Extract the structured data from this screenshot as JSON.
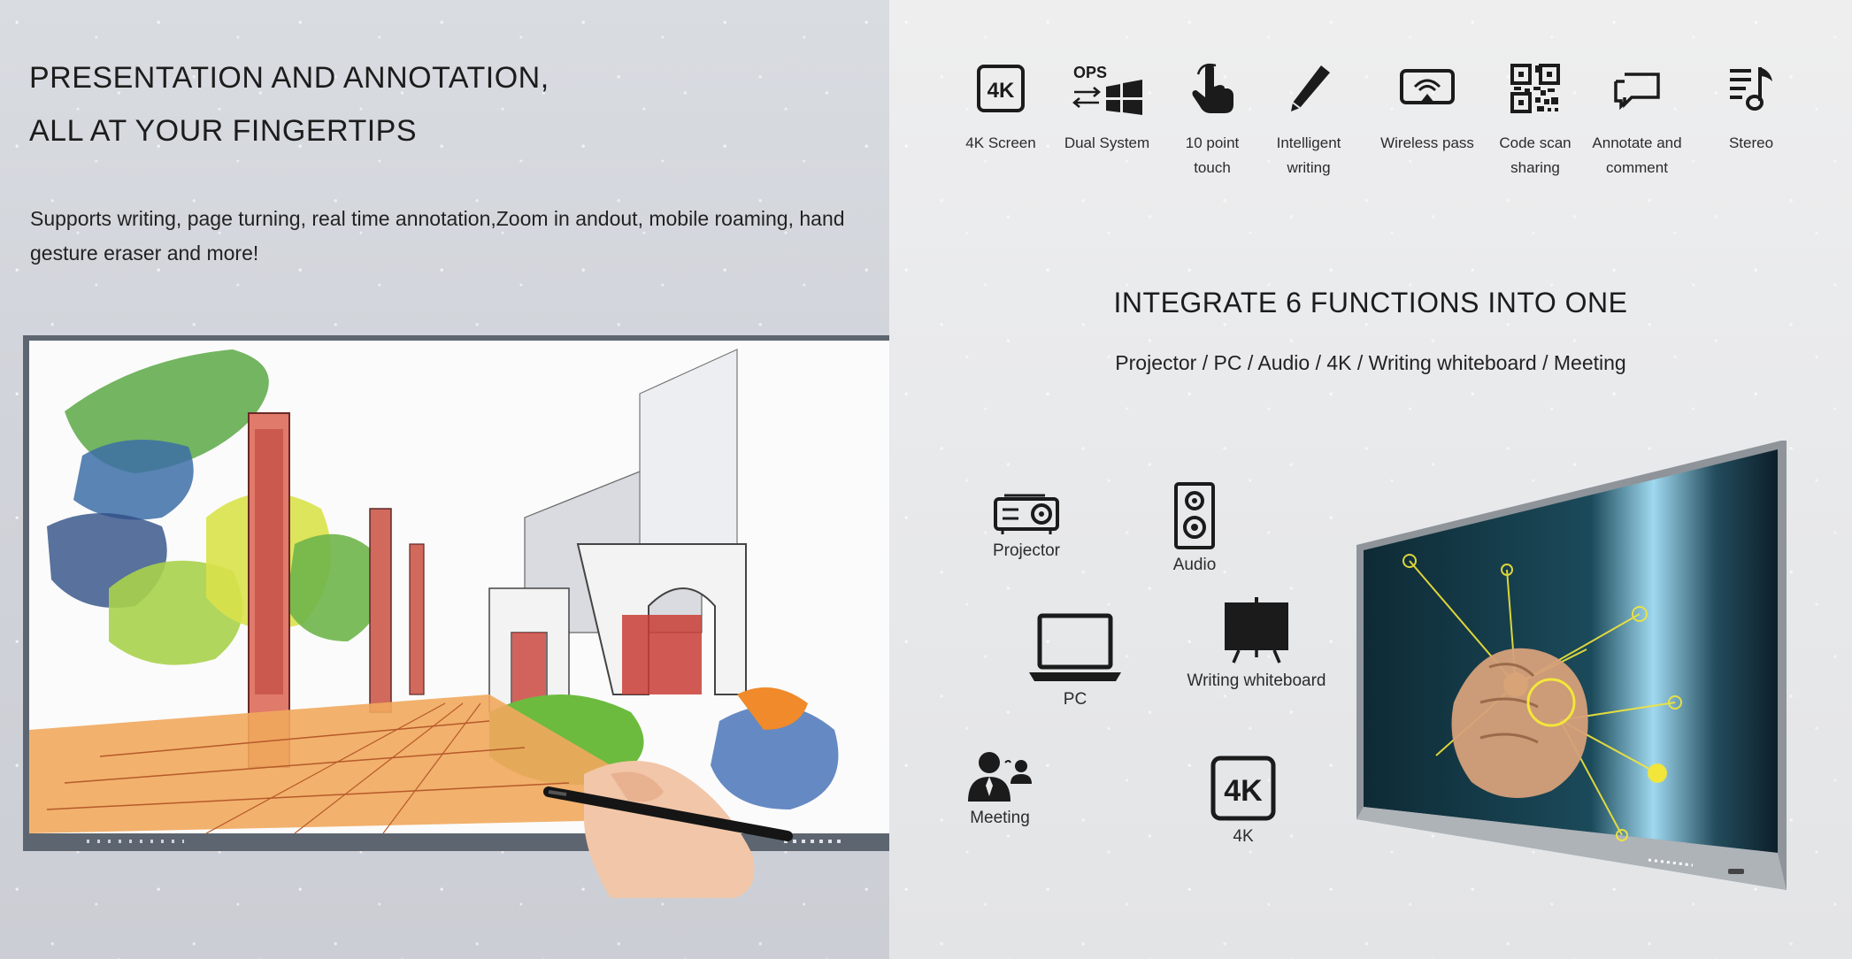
{
  "left": {
    "headline_line1": "PRESENTATION AND ANNOTATION,",
    "headline_line2": "ALL AT YOUR FINGERTIPS",
    "description": "Supports writing, page turning, real time annotation,Zoom in andout, mobile roaming, hand gesture eraser and more!"
  },
  "features": [
    {
      "label_line1": "4K Screen",
      "label_line2": "",
      "icon": "4k-badge-icon"
    },
    {
      "label_line1": "Dual System",
      "label_line2": "",
      "icon": "ops-windows-icon",
      "icon_text": "OPS"
    },
    {
      "label_line1": "10 point",
      "label_line2": "touch",
      "icon": "touch-hand-icon"
    },
    {
      "label_line1": "Intelligent",
      "label_line2": "writing",
      "icon": "pen-icon"
    },
    {
      "label_line1": "Wireless pass",
      "label_line2": "",
      "icon": "wireless-cast-icon"
    },
    {
      "label_line1": "Code scan",
      "label_line2": "sharing",
      "icon": "qr-code-icon"
    },
    {
      "label_line1": "Annotate and",
      "label_line2": "comment",
      "icon": "comment-icon"
    },
    {
      "label_line1": "Stereo",
      "label_line2": "",
      "icon": "music-note-icon"
    }
  ],
  "integrate": {
    "title": "INTEGRATE 6 FUNCTIONS INTO ONE",
    "subtitle": "Projector / PC / Audio / 4K / Writing whiteboard / Meeting"
  },
  "functions": {
    "projector": "Projector",
    "audio": "Audio",
    "pc": "PC",
    "whiteboard": "Writing whiteboard",
    "meeting": "Meeting",
    "fourk": "4K"
  },
  "icon_text": {
    "fourk_badge": "4K"
  },
  "colors": {
    "icon": "#1b1b1b",
    "frame": "#5d6670",
    "accent_yellow": "#f3e63a"
  }
}
